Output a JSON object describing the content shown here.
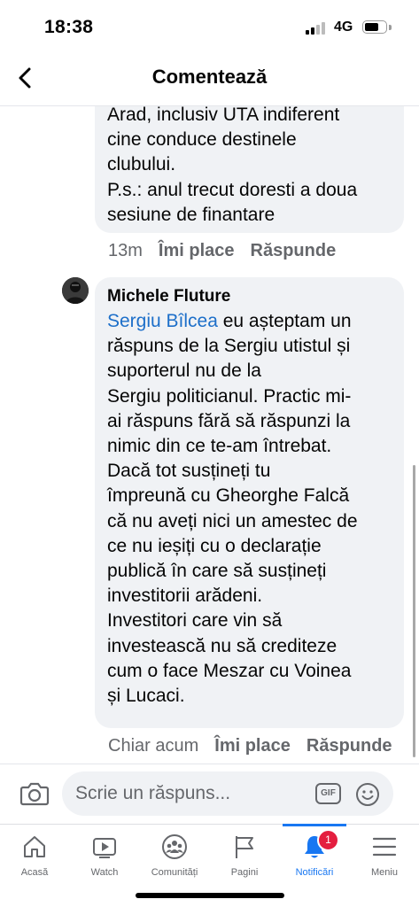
{
  "status": {
    "time": "18:38",
    "network": "4G"
  },
  "header": {
    "title": "Comentează"
  },
  "comments": [
    {
      "text": "Arad, inclusiv UTA indiferent\ncine conduce destinele\nclubului.\nP.s.: anul trecut doresti a doua\nsesiune de finantare",
      "time": "13m",
      "like": "Îmi place",
      "reply": "Răspunde"
    },
    {
      "author": "Michele Fluture",
      "mention": "Sergiu Bîlcea",
      "text": " eu așteptam un\nrăspuns de la Sergiu utistul și\nsuporterul nu de la\nSergiu politicianul. Practic mi-\nai răspuns fără să răspunzi la\nnimic din ce te-am întrebat.\nDacă tot susțineți tu\nîmpreună cu Gheorghe Falcă\ncă nu aveți nici un amestec de\nce nu ieșiți cu o declarație\npublică în care să susțineți\ninvestitorii arădeni.\nInvestitori care vin să\ninvestească nu să crediteze\ncum o face Meszar cu Voinea\nși Lucaci.",
      "time": "Chiar acum",
      "like": "Îmi place",
      "reply": "Răspunde"
    }
  ],
  "reply_bar": {
    "placeholder": "Scrie un răspuns...",
    "gif": "GIF"
  },
  "nav": {
    "items": [
      {
        "label": "Acasă",
        "icon": "home-icon"
      },
      {
        "label": "Watch",
        "icon": "watch-icon"
      },
      {
        "label": "Comunități",
        "icon": "groups-icon"
      },
      {
        "label": "Pagini",
        "icon": "flag-icon"
      },
      {
        "label": "Notificări",
        "icon": "bell-icon",
        "badge": "1",
        "active": true
      },
      {
        "label": "Meniu",
        "icon": "menu-icon"
      }
    ]
  },
  "colors": {
    "accent": "#1877f2",
    "mention": "#1d6fc9",
    "badge": "#e41e3f",
    "bubble": "#f0f2f5",
    "meta": "#65676b"
  }
}
